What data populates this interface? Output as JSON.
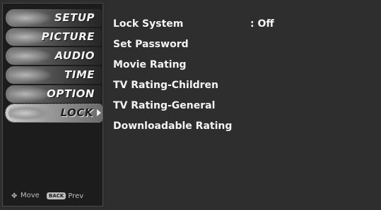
{
  "side_menu": {
    "items": [
      {
        "label": "SETUP"
      },
      {
        "label": "PICTURE"
      },
      {
        "label": "AUDIO"
      },
      {
        "label": "TIME"
      },
      {
        "label": "OPTION"
      },
      {
        "label": "LOCK"
      }
    ],
    "active_index": 5,
    "hints": {
      "move_label": "Move",
      "back_key_label": "BACK",
      "prev_label": "Prev"
    }
  },
  "lock_menu": {
    "rows": [
      {
        "label": "Lock System",
        "value": ": Off"
      },
      {
        "label": "Set Password"
      },
      {
        "label": "Movie Rating"
      },
      {
        "label": "TV Rating-Children"
      },
      {
        "label": "TV Rating-General"
      },
      {
        "label": "Downloadable Rating"
      }
    ]
  }
}
